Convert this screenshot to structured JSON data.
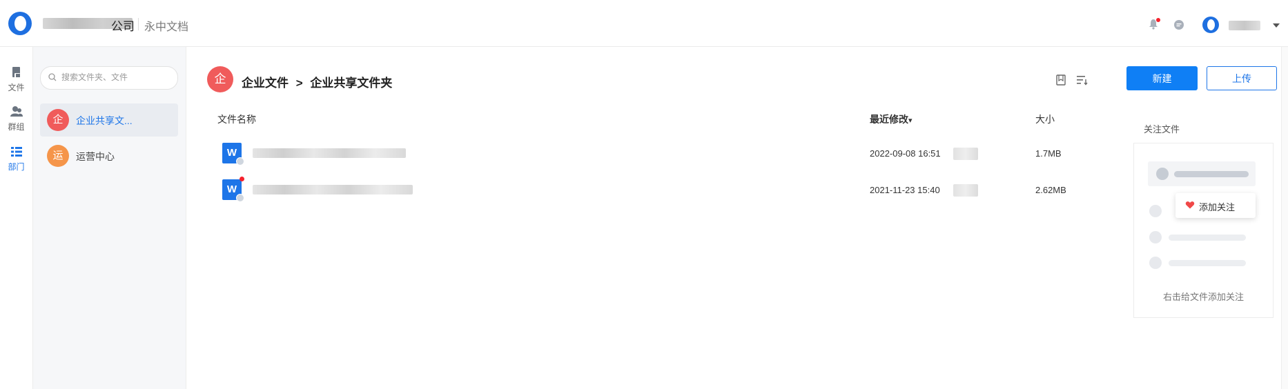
{
  "header": {
    "company_suffix": "公司",
    "product_name": "永中文档"
  },
  "rail": {
    "items": [
      {
        "label": "文件"
      },
      {
        "label": "群组"
      },
      {
        "label": "部门"
      }
    ]
  },
  "tree": {
    "search_placeholder": "搜索文件夹、文件",
    "items": [
      {
        "badge": "企",
        "label": "企业共享文...",
        "color": "#f05b5b"
      },
      {
        "badge": "运",
        "label": "运营中心",
        "color": "#f5954a"
      }
    ]
  },
  "main": {
    "breadcrumb_badge": "企",
    "breadcrumb": [
      "企业文件",
      ">",
      "企业共享文件夹"
    ],
    "new_button": "新建",
    "upload_button": "上传",
    "columns": {
      "name": "文件名称",
      "modified": "最近修改",
      "modified_sort": "▾",
      "size": "大小"
    },
    "files": [
      {
        "icon_letter": "W",
        "modified": "2022-09-08 16:51",
        "size": "1.7MB",
        "has_dot": false
      },
      {
        "icon_letter": "W",
        "modified": "2021-11-23 15:40",
        "size": "2.62MB",
        "has_dot": true
      }
    ]
  },
  "follow_panel": {
    "title": "关注文件",
    "popup_label": "添加关注",
    "hint": "右击给文件添加关注"
  },
  "colors": {
    "accent": "#0f7ff5",
    "badge_red": "#f05b5b",
    "badge_orange": "#f5954a",
    "notification": "#f5222d"
  }
}
